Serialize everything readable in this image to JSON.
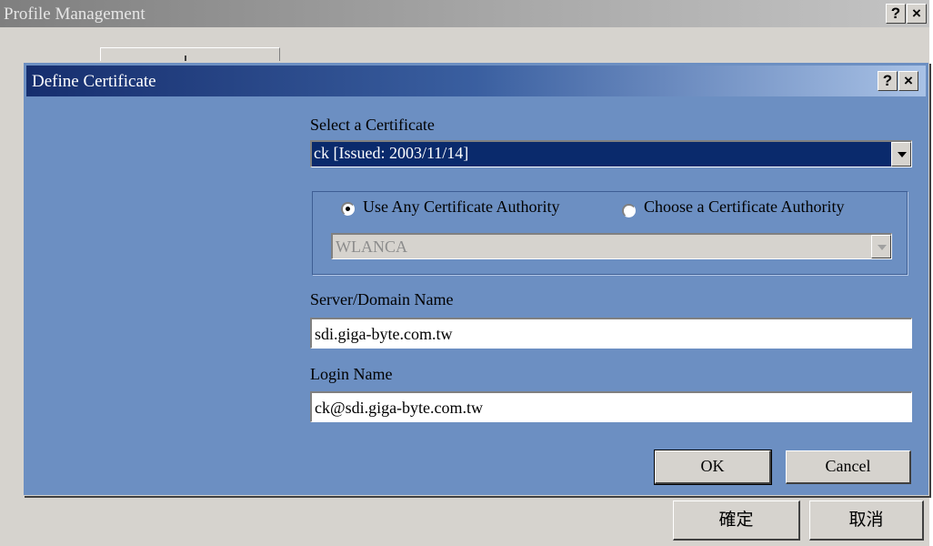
{
  "outer_window": {
    "title": "Profile Management",
    "help_label": "?",
    "close_label": "×",
    "ok_label": "確定",
    "cancel_label": "取消"
  },
  "dialog": {
    "title": "Define Certificate",
    "help_label": "?",
    "close_label": "×",
    "select_certificate": {
      "label": "Select a Certificate",
      "value": "ck  [Issued: 2003/11/14]"
    },
    "ca_group": {
      "options": [
        {
          "label": "Use Any Certificate Authority",
          "selected": true
        },
        {
          "label": "Choose a Certificate Authority",
          "selected": false
        }
      ],
      "ca_select_value": "WLANCA",
      "ca_select_enabled": false
    },
    "server_domain": {
      "label": "Server/Domain Name",
      "value": "sdi.giga-byte.com.tw"
    },
    "login_name": {
      "label": "Login Name",
      "value": "ck@sdi.giga-byte.com.tw"
    },
    "ok_label": "OK",
    "cancel_label": "Cancel"
  },
  "colors": {
    "dialog_background": "#6c8fc2",
    "dialog_titlebar": "#162e6e",
    "selection_background": "#0a2a6c",
    "window_face": "#d6d3ce"
  }
}
